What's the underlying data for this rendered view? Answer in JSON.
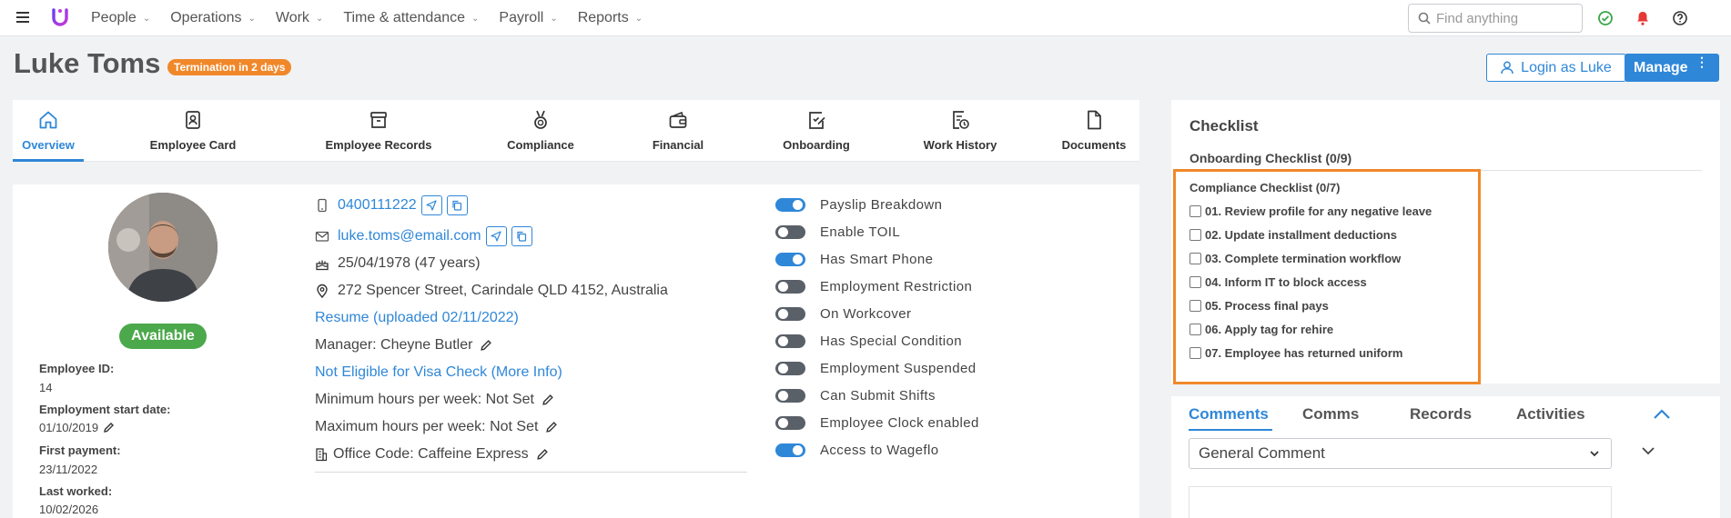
{
  "nav": {
    "items": [
      {
        "label": "People"
      },
      {
        "label": "Operations"
      },
      {
        "label": "Work"
      },
      {
        "label": "Time & attendance"
      },
      {
        "label": "Payroll"
      },
      {
        "label": "Reports"
      }
    ],
    "search_placeholder": "Find anything"
  },
  "header": {
    "name": "Luke Toms",
    "termination_badge": "Termination in 2 days",
    "login_label": "Login as Luke",
    "manage_label": "Manage"
  },
  "tabs": [
    {
      "label": "Overview",
      "icon": "home-icon"
    },
    {
      "label": "Employee Card",
      "icon": "id-card-icon"
    },
    {
      "label": "Employee Records",
      "icon": "archive-icon"
    },
    {
      "label": "Compliance",
      "icon": "medal-icon"
    },
    {
      "label": "Financial",
      "icon": "wallet-icon"
    },
    {
      "label": "Onboarding",
      "icon": "checklist-icon"
    },
    {
      "label": "Work History",
      "icon": "history-icon"
    },
    {
      "label": "Documents",
      "icon": "document-icon"
    }
  ],
  "profile": {
    "status": "Available",
    "fields": [
      {
        "label": "Employee ID:",
        "value": "14"
      },
      {
        "label": "Employment start date:",
        "value": "01/10/2019"
      },
      {
        "label": "First payment:",
        "value": "23/11/2022"
      },
      {
        "label": "Last worked:",
        "value": "10/02/2026"
      }
    ]
  },
  "contact": {
    "phone": "0400111222",
    "email": "luke.toms@email.com",
    "dob": "25/04/1978 (47 years)",
    "address": "272 Spencer Street, Carindale QLD 4152, Australia",
    "resume": "Resume (uploaded 02/11/2022)",
    "manager": "Manager: Cheyne Butler",
    "visa": "Not Eligible for Visa Check (More Info)",
    "min_hours": "Minimum hours per week: Not Set",
    "max_hours": "Maximum hours per week: Not Set",
    "office": "Office Code: Caffeine Express"
  },
  "toggles": [
    {
      "label": "Payslip Breakdown",
      "on": true
    },
    {
      "label": "Enable TOIL",
      "on": false
    },
    {
      "label": "Has Smart Phone",
      "on": true
    },
    {
      "label": "Employment Restriction",
      "on": false
    },
    {
      "label": "On Workcover",
      "on": false
    },
    {
      "label": "Has Special Condition",
      "on": false
    },
    {
      "label": "Employment Suspended",
      "on": false
    },
    {
      "label": "Can Submit Shifts",
      "on": false
    },
    {
      "label": "Employee Clock enabled",
      "on": false
    },
    {
      "label": "Access to Wageflo",
      "on": true
    }
  ],
  "checklist": {
    "title": "Checklist",
    "onboarding": "Onboarding Checklist (0/9)",
    "compliance": "Compliance Checklist (0/7)",
    "items": [
      "01. Review profile for any negative leave",
      "02. Update installment deductions",
      "03. Complete termination workflow",
      "04. Inform IT to block access",
      "05. Process final pays",
      "06. Apply tag for rehire",
      "07. Employee has returned uniform"
    ]
  },
  "comments": {
    "tabs": [
      "Comments",
      "Comms",
      "Records",
      "Activities"
    ],
    "type_selected": "General Comment"
  },
  "colors": {
    "accent": "#2f87d8",
    "warning": "#f0882a",
    "success": "#4ba84b"
  }
}
